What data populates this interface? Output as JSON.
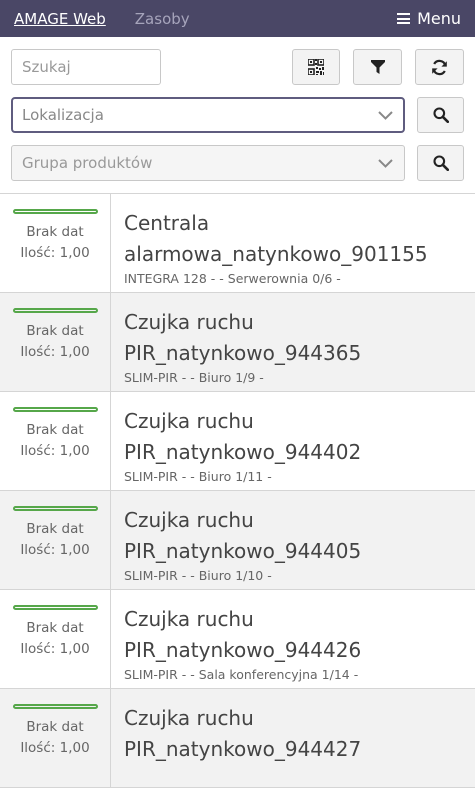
{
  "navbar": {
    "brand": "AMAGE Web",
    "link": "Zasoby",
    "menu_label": "Menu"
  },
  "filters": {
    "search_placeholder": "Szukaj",
    "location_placeholder": "Lokalizacja",
    "group_placeholder": "Grupa produktów"
  },
  "items": [
    {
      "status": "Brak dat",
      "qty": "Ilość: 1,00",
      "title": "Centrala alarmowa_natynkowo_901155",
      "sub": "INTEGRA 128 - - Serwerownia 0/6 -"
    },
    {
      "status": "Brak dat",
      "qty": "Ilość: 1,00",
      "title": "Czujka ruchu PIR_natynkowo_944365",
      "sub": "SLIM-PIR - - Biuro 1/9 -"
    },
    {
      "status": "Brak dat",
      "qty": "Ilość: 1,00",
      "title": "Czujka ruchu PIR_natynkowo_944402",
      "sub": "SLIM-PIR - - Biuro 1/11 -"
    },
    {
      "status": "Brak dat",
      "qty": "Ilość: 1,00",
      "title": "Czujka ruchu PIR_natynkowo_944405",
      "sub": "SLIM-PIR - - Biuro 1/10 -"
    },
    {
      "status": "Brak dat",
      "qty": "Ilość: 1,00",
      "title": "Czujka ruchu PIR_natynkowo_944426",
      "sub": "SLIM-PIR - - Sala konferencyjna 1/14 -"
    },
    {
      "status": "Brak dat",
      "qty": "Ilość: 1,00",
      "title": "Czujka ruchu PIR_natynkowo_944427",
      "sub": ""
    }
  ],
  "colors": {
    "navbar": "#4a4766",
    "status_bar": "#56a74a"
  }
}
